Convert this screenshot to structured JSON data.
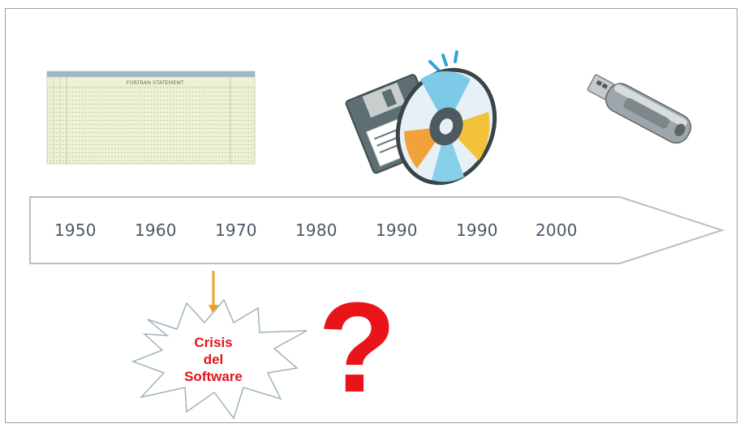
{
  "timeline": {
    "years": [
      "1950",
      "1960",
      "1970",
      "1980",
      "1990",
      "1990",
      "2000"
    ]
  },
  "media": {
    "punch_card_header": "FORTRAN STATEMENT"
  },
  "crisis": {
    "line1": "Crisis",
    "line2": "del",
    "line3": "Software"
  },
  "question_mark": "?",
  "colors": {
    "arrow_pointer": "#f0a020",
    "crisis_text": "#e0161b",
    "question_mark": "#e8141a",
    "year_text": "#4d5866",
    "timeline_border": "#b9bfc8"
  }
}
